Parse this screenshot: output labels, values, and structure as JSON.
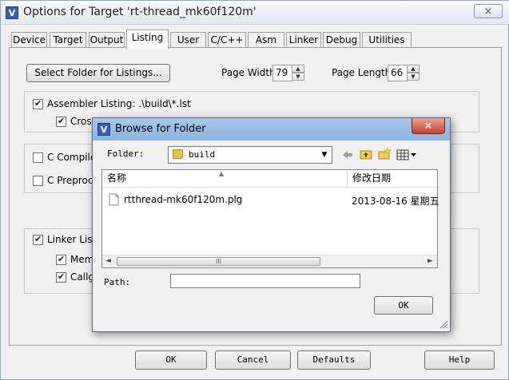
{
  "window": {
    "title": "Options for Target 'rt-thread_mk60f120m'",
    "close": "×",
    "icon": "V"
  },
  "tabs": [
    "Device",
    "Target",
    "Output",
    "Listing",
    "User",
    "C/C++",
    "Asm",
    "Linker",
    "Debug",
    "Utilities"
  ],
  "active_tab": "Listing",
  "listing": {
    "select_folder_button": "Select Folder for Listings...",
    "page_width_label": "Page Width:",
    "page_width_value": "79",
    "page_length_label": "Page Length:",
    "page_length_value": "66",
    "assembler_listing_label": "Assembler Listing:  .\\build\\*.lst",
    "assembler_listing_checked": true,
    "cross_reference_label": "Cross R",
    "cross_reference_checked": true,
    "c_compiler_listing_label": "C Compiler Li",
    "c_compiler_listing_checked": false,
    "c_preprocessor_listing_label": "C Preproces",
    "c_preprocessor_listing_checked": false,
    "linker_listing_label": "Linker Listing",
    "linker_listing_checked": true,
    "memory_map_label": "Memo",
    "memory_map_checked": true,
    "callgraph_label": "Callgra",
    "callgraph_checked": true
  },
  "footer": {
    "ok": "OK",
    "cancel": "Cancel",
    "defaults": "Defaults",
    "help": "Help"
  },
  "dialog": {
    "title": "Browse for Folder",
    "icon": "V",
    "close": "×",
    "folder_label": "Folder:",
    "folder_value": "build",
    "column_name": "名称",
    "column_modified": "修改日期",
    "files": [
      {
        "name": "rtthread-mk60f120m.plg",
        "modified": "2013-08-16 星期五"
      }
    ],
    "scroll_thumb": "III",
    "path_label": "Path:",
    "path_value": "",
    "ok": "OK"
  },
  "icons": {
    "back": "back-arrow-icon",
    "up": "up-folder-icon",
    "new": "new-folder-icon",
    "view": "view-menu-icon"
  }
}
